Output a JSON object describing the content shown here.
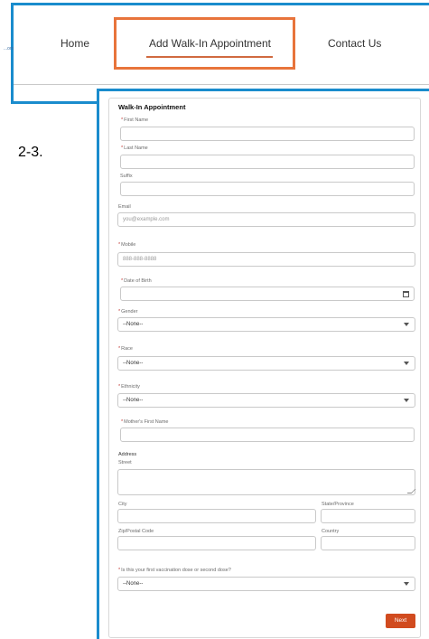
{
  "nav": {
    "logo_text": "...om",
    "items": [
      {
        "label": "Home"
      },
      {
        "label": "Add Walk-In Appointment"
      },
      {
        "label": "Contact Us"
      }
    ]
  },
  "step_label": "2-3.",
  "form": {
    "title": "Walk-In Appointment",
    "first_name_label": "First Name",
    "last_name_label": "Last Name",
    "suffix_label": "Suffix",
    "email_label": "Email",
    "email_placeholder": "you@example.com",
    "mobile_label": "Mobile",
    "mobile_placeholder": "888-888-8888",
    "dob_label": "Date of Birth",
    "gender_label": "Gender",
    "gender_value": "--None--",
    "race_label": "Race",
    "race_value": "--None--",
    "ethnicity_label": "Ethnicity",
    "ethnicity_value": "--None--",
    "mother_label": "Mother's First Name",
    "address_heading": "Address",
    "street_label": "Street",
    "city_label": "City",
    "state_label": "State/Province",
    "zip_label": "Zip/Postal Code",
    "country_label": "Country",
    "dose_label": "Is this your first vaccination dose or second dose?",
    "dose_value": "--None--",
    "required_marker": "*",
    "next_label": "Next"
  },
  "colors": {
    "nav_callout_border": "#1a8ccd",
    "nav_highlight": "#e8743b",
    "next_button": "#d14b1f",
    "required": "#c23934"
  },
  "icons": {
    "calendar": "calendar-icon",
    "dropdown": "chevron-down-icon"
  }
}
